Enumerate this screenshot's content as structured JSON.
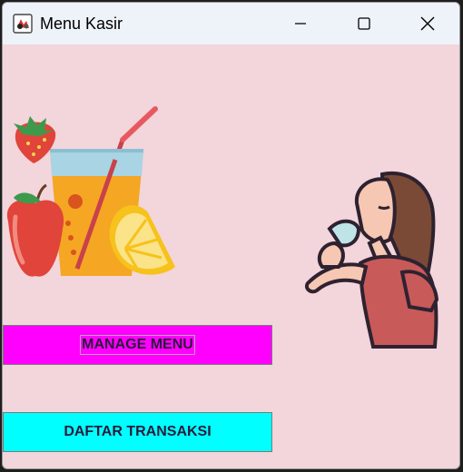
{
  "window": {
    "title": "Menu Kasir",
    "controls": {
      "minimize": "minimize",
      "maximize": "maximize",
      "close": "close"
    }
  },
  "buttons": {
    "manage_menu": "MANAGE MENU",
    "daftar_transaksi": "DAFTAR TRANSAKSI"
  },
  "colors": {
    "background": "#f3d5dc",
    "manage_button": "#ff00ff",
    "daftar_button": "#00ffff"
  },
  "images": {
    "left": "juice-fruit-illustration",
    "right": "woman-drinking-illustration"
  }
}
